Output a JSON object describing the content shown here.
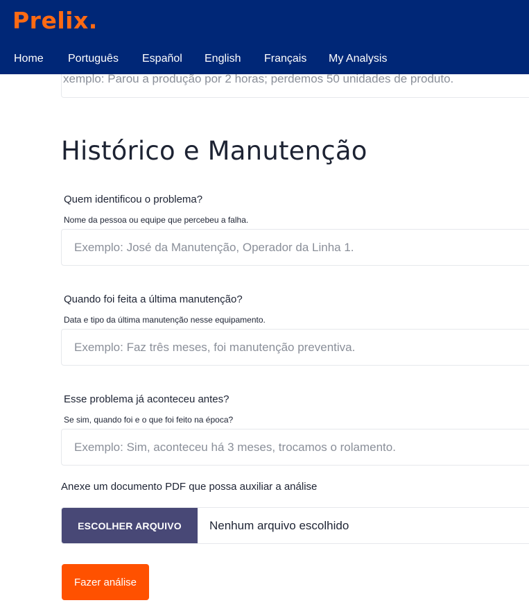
{
  "brand": {
    "logo_text": "Prelix."
  },
  "nav": [
    {
      "label": "Home"
    },
    {
      "label": "Português"
    },
    {
      "label": "Español"
    },
    {
      "label": "English"
    },
    {
      "label": "Français"
    },
    {
      "label": "My Analysis"
    }
  ],
  "previous_field": {
    "placeholder_partial": "xemplo: Parou a produção por 2 horas; perdemos 50 unidades de produto."
  },
  "section": {
    "title": "Histórico e Manutenção"
  },
  "fields": [
    {
      "label": "Quem identificou o problema?",
      "hint": "Nome da pessoa ou equipe que percebeu a falha.",
      "placeholder": "Exemplo: José da Manutenção, Operador da Linha 1."
    },
    {
      "label": "Quando foi feita a última manutenção?",
      "hint": "Data e tipo da última manutenção nesse equipamento.",
      "placeholder": "Exemplo: Faz três meses, foi manutenção preventiva."
    },
    {
      "label": "Esse problema já aconteceu antes?",
      "hint": "Se sim, quando foi e o que foi feito na época?",
      "placeholder": "Exemplo: Sim, aconteceu há 3 meses, trocamos o rolamento."
    }
  ],
  "attachment": {
    "label": "Anexe um documento PDF que possa auxiliar a análise",
    "button_label": "ESCOLHER ARQUIVO",
    "status": "Nenhum arquivo escolhido"
  },
  "submit": {
    "label": "Fazer análise"
  },
  "colors": {
    "header_bg": "#002777",
    "brand_orange": "#ff6a13",
    "submit_orange": "#ff5100",
    "file_button": "#484876"
  }
}
